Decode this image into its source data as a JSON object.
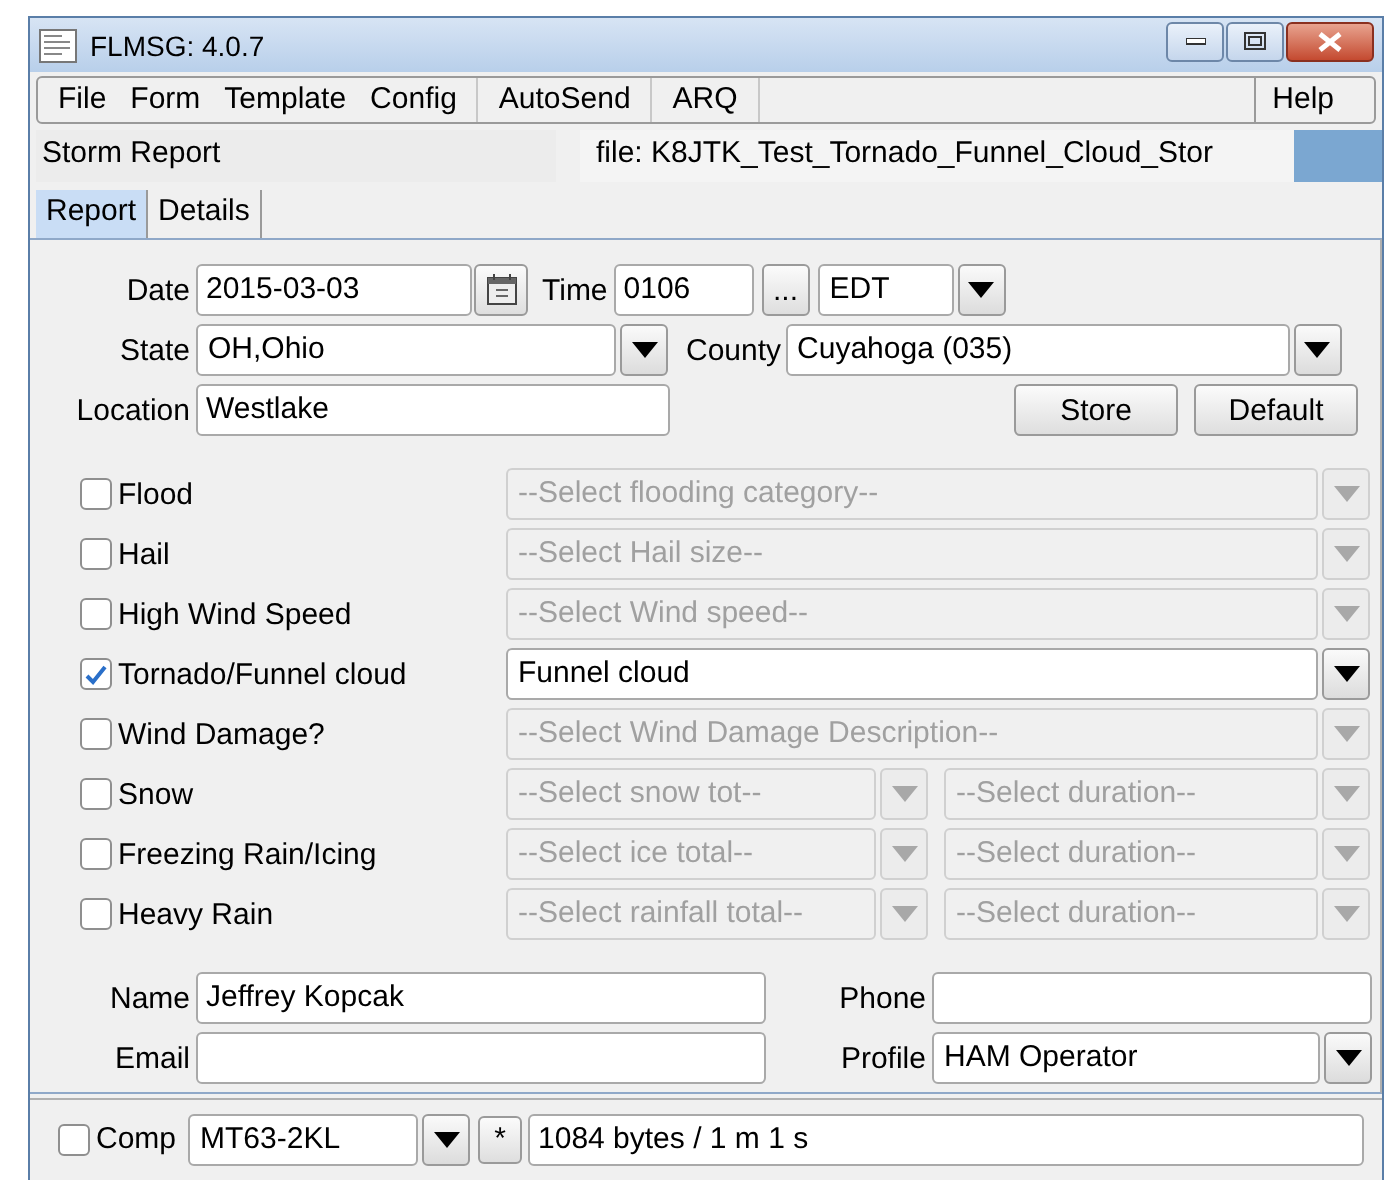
{
  "window": {
    "title": "FLMSG: 4.0.7"
  },
  "menu_groups": [
    [
      "File",
      "Form",
      "Template",
      "Config"
    ],
    [
      "AutoSend"
    ],
    [
      "ARQ"
    ]
  ],
  "help_menu": "Help",
  "form_bar": {
    "form_name": "Storm Report",
    "file_label": "file: K8JTK_Test_Tornado_Funnel_Cloud_Stor"
  },
  "tabs": [
    {
      "label": "Report",
      "selected": true
    },
    {
      "label": "Details",
      "selected": false
    }
  ],
  "report": {
    "date": {
      "label": "Date",
      "value": "2015-03-03"
    },
    "time": {
      "label": "Time",
      "value": "0106"
    },
    "time_button": "...",
    "timezone": "EDT",
    "state": {
      "label": "State",
      "value": "OH,Ohio"
    },
    "county": {
      "label": "County",
      "value": "Cuyahoga  (035)"
    },
    "location": {
      "label": "Location",
      "value": "Westlake"
    },
    "buttons": [
      "Store",
      "Default"
    ],
    "hazards": [
      {
        "label": "Flood",
        "checked": false,
        "selects": [
          {
            "text": "--Select flooding category--",
            "disabled": true
          }
        ]
      },
      {
        "label": "Hail",
        "checked": false,
        "selects": [
          {
            "text": "--Select Hail size--",
            "disabled": true
          }
        ]
      },
      {
        "label": "High Wind Speed",
        "checked": false,
        "selects": [
          {
            "text": "--Select Wind speed--",
            "disabled": true
          }
        ]
      },
      {
        "label": "Tornado/Funnel cloud",
        "checked": true,
        "selects": [
          {
            "text": "Funnel cloud",
            "disabled": false
          }
        ]
      },
      {
        "label": "Wind Damage?",
        "checked": false,
        "selects": [
          {
            "text": "--Select Wind Damage Description--",
            "disabled": true
          }
        ]
      },
      {
        "label": "Snow",
        "checked": false,
        "selects": [
          {
            "text": "--Select snow tot--",
            "disabled": true
          },
          {
            "text": "--Select duration--",
            "disabled": true
          }
        ]
      },
      {
        "label": "Freezing Rain/Icing",
        "checked": false,
        "selects": [
          {
            "text": "--Select ice total--",
            "disabled": true
          },
          {
            "text": "--Select duration--",
            "disabled": true
          }
        ]
      },
      {
        "label": "Heavy Rain",
        "checked": false,
        "selects": [
          {
            "text": "--Select rainfall total--",
            "disabled": true
          },
          {
            "text": "--Select duration--",
            "disabled": true
          }
        ]
      }
    ],
    "name": {
      "label": "Name",
      "value": "Jeffrey Kopcak"
    },
    "phone": {
      "label": "Phone"
    },
    "email": {
      "label": "Email"
    },
    "profile": {
      "label": "Profile",
      "value": "HAM Operator"
    }
  },
  "status_bar": {
    "compress": {
      "label": "Comp",
      "checked": false
    },
    "mode": "MT63-2KL",
    "star_button": "*",
    "size": "1084 bytes / 1 m 1 s"
  }
}
